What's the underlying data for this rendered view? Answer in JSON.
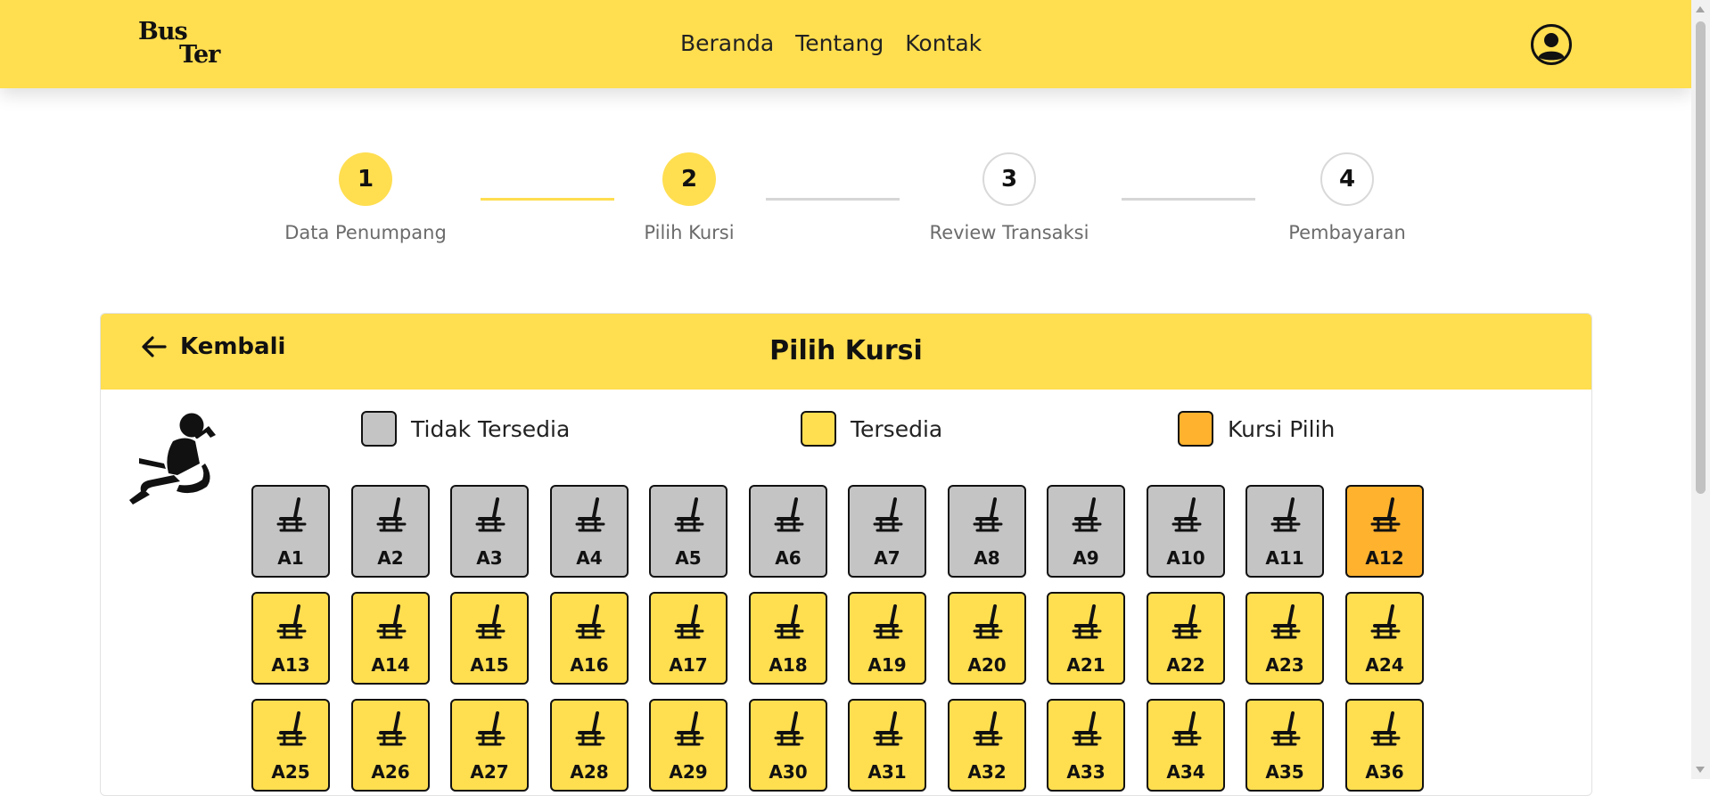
{
  "navbar": {
    "logo_line1": "Bus",
    "logo_line2": "Ter",
    "links": [
      "Beranda",
      "Tentang",
      "Kontak"
    ],
    "user_icon": "user-circle-icon"
  },
  "stepper": {
    "steps": [
      {
        "number": "1",
        "label": "Data Penumpang",
        "state": "done"
      },
      {
        "number": "2",
        "label": "Pilih Kursi",
        "state": "active"
      },
      {
        "number": "3",
        "label": "Review Transaksi",
        "state": "pending"
      },
      {
        "number": "4",
        "label": "Pembayaran",
        "state": "pending"
      }
    ]
  },
  "card": {
    "back_label": "Kembali",
    "title": "Pilih Kursi",
    "driver_icon": "driver-seat-icon"
  },
  "legend": [
    {
      "label": "Tidak Tersedia",
      "status": "unavailable"
    },
    {
      "label": "Tersedia",
      "status": "available"
    },
    {
      "label": "Kursi Pilih",
      "status": "selected"
    }
  ],
  "colors": {
    "brand_yellow": "#ffde50",
    "unavailable": "#c4c4c4",
    "available": "#ffde50",
    "selected": "#ffb22e"
  },
  "seats": [
    {
      "id": "A1",
      "status": "unavailable"
    },
    {
      "id": "A2",
      "status": "unavailable"
    },
    {
      "id": "A3",
      "status": "unavailable"
    },
    {
      "id": "A4",
      "status": "unavailable"
    },
    {
      "id": "A5",
      "status": "unavailable"
    },
    {
      "id": "A6",
      "status": "unavailable"
    },
    {
      "id": "A7",
      "status": "unavailable"
    },
    {
      "id": "A8",
      "status": "unavailable"
    },
    {
      "id": "A9",
      "status": "unavailable"
    },
    {
      "id": "A10",
      "status": "unavailable"
    },
    {
      "id": "A11",
      "status": "unavailable"
    },
    {
      "id": "A12",
      "status": "selected"
    },
    {
      "id": "A13",
      "status": "available"
    },
    {
      "id": "A14",
      "status": "available"
    },
    {
      "id": "A15",
      "status": "available"
    },
    {
      "id": "A16",
      "status": "available"
    },
    {
      "id": "A17",
      "status": "available"
    },
    {
      "id": "A18",
      "status": "available"
    },
    {
      "id": "A19",
      "status": "available"
    },
    {
      "id": "A20",
      "status": "available"
    },
    {
      "id": "A21",
      "status": "available"
    },
    {
      "id": "A22",
      "status": "available"
    },
    {
      "id": "A23",
      "status": "available"
    },
    {
      "id": "A24",
      "status": "available"
    },
    {
      "id": "A25",
      "status": "available"
    },
    {
      "id": "A26",
      "status": "available"
    },
    {
      "id": "A27",
      "status": "available"
    },
    {
      "id": "A28",
      "status": "available"
    },
    {
      "id": "A29",
      "status": "available"
    },
    {
      "id": "A30",
      "status": "available"
    },
    {
      "id": "A31",
      "status": "available"
    },
    {
      "id": "A32",
      "status": "available"
    },
    {
      "id": "A33",
      "status": "available"
    },
    {
      "id": "A34",
      "status": "available"
    },
    {
      "id": "A35",
      "status": "available"
    },
    {
      "id": "A36",
      "status": "available"
    }
  ]
}
